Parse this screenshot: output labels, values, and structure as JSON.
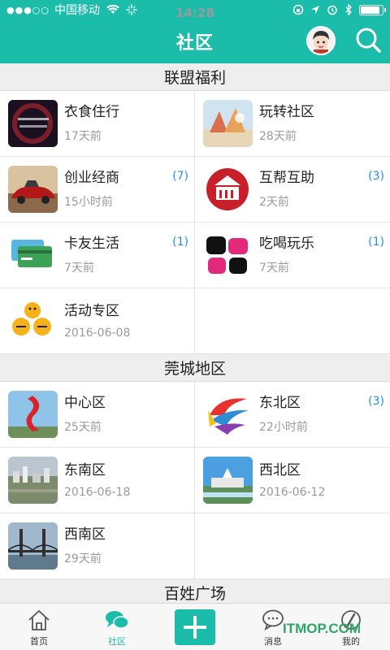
{
  "status_bar": {
    "signal": "●●●○○",
    "carrier": "中国移动",
    "time": "14:28",
    "battery_level": 0.9
  },
  "header": {
    "title": "社区",
    "avatar_icon": "user-avatar",
    "search_icon": "search-icon"
  },
  "sections": [
    {
      "title": "联盟福利",
      "items": [
        {
          "name": "衣食住行",
          "time": "17天前",
          "count": "",
          "icon": "dark-card-thumb"
        },
        {
          "name": "玩转社区",
          "time": "28天前",
          "count": "",
          "icon": "community-photo-thumb"
        },
        {
          "name": "创业经商",
          "time": "15小时前",
          "count": "(7)",
          "icon": "car-thumb"
        },
        {
          "name": "互帮互助",
          "time": "2天前",
          "count": "(3)",
          "icon": "hands-logo-thumb"
        },
        {
          "name": "卡友生活",
          "time": "7天前",
          "count": "(1)",
          "icon": "credit-cards-thumb"
        },
        {
          "name": "吃喝玩乐",
          "time": "7天前",
          "count": "(1)",
          "icon": "eat-play-logo-thumb"
        },
        {
          "name": "活动专区",
          "time": "2016-06-08",
          "count": "",
          "icon": "event-logo-thumb"
        }
      ]
    },
    {
      "title": "莞城地区",
      "items": [
        {
          "name": "中心区",
          "time": "25天前",
          "count": "",
          "icon": "red-sculpture-thumb"
        },
        {
          "name": "东北区",
          "time": "22小时前",
          "count": "(3)",
          "icon": "colorful-logo-thumb"
        },
        {
          "name": "东南区",
          "time": "2016-06-18",
          "count": "",
          "icon": "city-aerial-thumb"
        },
        {
          "name": "西北区",
          "time": "2016-06-12",
          "count": "",
          "icon": "plaza-thumb"
        },
        {
          "name": "西南区",
          "time": "29天前",
          "count": "",
          "icon": "bridge-thumb"
        }
      ]
    },
    {
      "title": "百姓广场",
      "items": []
    }
  ],
  "tabbar": {
    "tabs": [
      {
        "label": "首页",
        "icon": "home-icon"
      },
      {
        "label": "社区",
        "icon": "chat-bubbles-icon"
      },
      {
        "label": "",
        "icon": "plus-icon"
      },
      {
        "label": "消息",
        "icon": "message-icon"
      },
      {
        "label": "我的",
        "icon": "profile-icon"
      }
    ],
    "active_index": 1
  },
  "watermark": "ITMOP.COM",
  "colors": {
    "accent": "#1cbcab",
    "count": "#2a8fd6"
  }
}
